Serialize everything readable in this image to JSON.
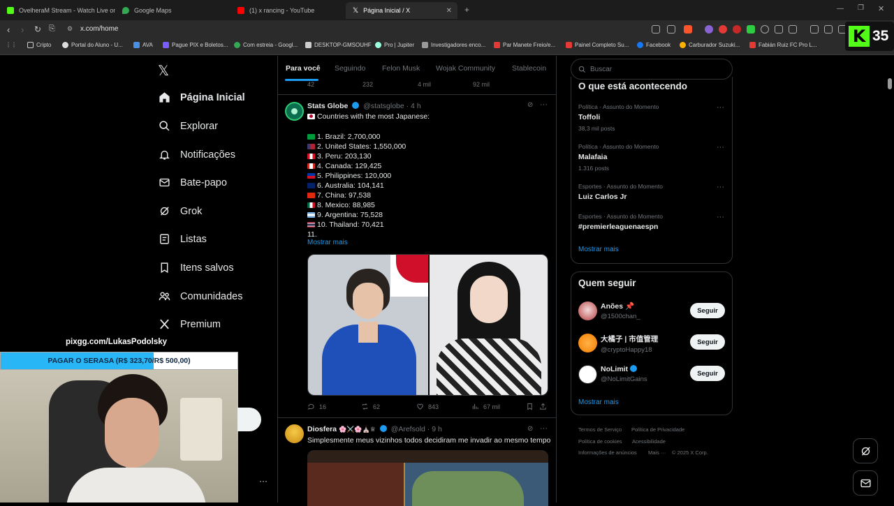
{
  "browser": {
    "tabs": [
      {
        "title": "OvelheraM Stream - Watch Live on K",
        "color": "#53fc18"
      },
      {
        "title": "Google Maps",
        "color": "#34a853"
      },
      {
        "title": "(1) x rancing - YouTube",
        "color": "#ff0000"
      },
      {
        "title": "Página Inicial / X",
        "color": "#ffffff"
      }
    ],
    "url": "x.com/home",
    "bookmarks": [
      "Cripto",
      "Portal do Aluno - U...",
      "AVA",
      "Pague PIX e Boletos...",
      "Com estreia - Googl...",
      "DESKTOP-GMSOUHF",
      "Pro | Jupiter",
      "Investigadores enco...",
      "Par Manete Freio/e...",
      "Painel Completo Su...",
      "Facebook",
      "Carburador Suzuki...",
      "Fabián Ruiz FC Pro L..."
    ],
    "badge_number": "35"
  },
  "sidebar": {
    "items": [
      {
        "label": "Página Inicial",
        "icon": "home-icon"
      },
      {
        "label": "Explorar",
        "icon": "search-icon"
      },
      {
        "label": "Notificações",
        "icon": "bell-icon"
      },
      {
        "label": "Bate-papo",
        "icon": "mail-icon"
      },
      {
        "label": "Grok",
        "icon": "grok-icon"
      },
      {
        "label": "Listas",
        "icon": "list-icon"
      },
      {
        "label": "Itens salvos",
        "icon": "bookmark-icon"
      },
      {
        "label": "Comunidades",
        "icon": "people-icon"
      },
      {
        "label": "Premium",
        "icon": "x-icon"
      }
    ]
  },
  "overlay": {
    "pix_url": "pixgg.com/LukasPodolsky",
    "goal_text": "PAGAR O SERASA (R$ 323,70/R$ 500,00)",
    "goal_progress": 0.6474
  },
  "feed": {
    "tabs": [
      "Para você",
      "Seguindo",
      "Felon Musk",
      "Wojak Community",
      "Stablecoin"
    ],
    "top_stats": {
      "replies": "42",
      "reposts": "232",
      "likes": "4 mil",
      "views": "92 mil"
    },
    "tweet1": {
      "name": "Stats Globe",
      "handle": "@statsglobe · 4 h",
      "headline": "Countries with the most Japanese:",
      "list": [
        "1. Brazil: 2,700,000",
        "2. United States: 1,550,000",
        "3. Peru: 203,130",
        "4. Canada: 129,425",
        "5. Philippines: 120,000",
        "6. Australia: 104,141",
        "7. China: 97,538",
        "8. Mexico: 88,985",
        "9. Argentina: 75,528",
        "10. Thailand: 70,421",
        "11."
      ],
      "show_more": "Mostrar mais",
      "stats": {
        "replies": "16",
        "reposts": "62",
        "likes": "843",
        "views": "67 mil"
      }
    },
    "tweet2": {
      "name": "Diosfera",
      "handle": "@Arefsold · 9 h",
      "text": "Simplesmente meus vizinhos todos decidiram me invadir ao mesmo tempo"
    }
  },
  "right": {
    "search_placeholder": "Buscar",
    "trends_title": "O que está acontecendo",
    "trends": [
      {
        "category": "Política · Assunto do Momento",
        "name": "Toffoli",
        "count": "38,3 mil posts"
      },
      {
        "category": "Política · Assunto do Momento",
        "name": "Malafaia",
        "count": "1.316 posts"
      },
      {
        "category": "Esportes · Assunto do Momento",
        "name": "Luiz Carlos Jr",
        "count": ""
      },
      {
        "category": "Esportes · Assunto do Momento",
        "name": "#premierleaguenaespn",
        "count": ""
      }
    ],
    "show_more": "Mostrar mais",
    "who_title": "Quem seguir",
    "who": [
      {
        "name": "Anões 📌",
        "handle": "@1500chan_",
        "button": "Seguir"
      },
      {
        "name": "大橘子 | 市值管理",
        "handle": "@cryptoHappy18",
        "button": "Seguir"
      },
      {
        "name": "NoLimit",
        "handle": "@NoLimitGains",
        "button": "Seguir"
      }
    ],
    "who_more": "Mostrar mais",
    "footer": [
      "Termos de Serviço",
      "Política de Privacidade",
      "Política de cookies",
      "Acessibilidade",
      "Informações de anúncios",
      "Mais ···",
      "© 2025 X Corp."
    ]
  }
}
